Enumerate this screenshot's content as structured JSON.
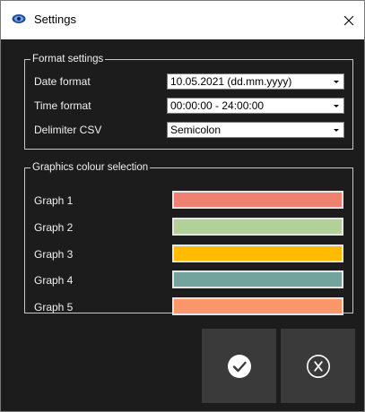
{
  "window": {
    "title": "Settings",
    "icon": "settings-app-icon",
    "close_glyph": "✕"
  },
  "format_settings": {
    "legend": "Format settings",
    "rows": [
      {
        "label": "Date format",
        "value": "10.05.2021 (dd.mm.yyyy)"
      },
      {
        "label": "Time format",
        "value": "00:00:00 - 24:00:00"
      },
      {
        "label": "Delimiter CSV",
        "value": "Semicolon"
      }
    ]
  },
  "graphics_colour_selection": {
    "legend": "Graphics colour selection",
    "rows": [
      {
        "label": "Graph 1",
        "color": "#f08070"
      },
      {
        "label": "Graph 2",
        "color": "#b2d09a"
      },
      {
        "label": "Graph 3",
        "color": "#ffbb00"
      },
      {
        "label": "Graph 4",
        "color": "#72a39c"
      },
      {
        "label": "Graph 5",
        "color": "#f9966a"
      }
    ]
  },
  "buttons": {
    "ok_icon": "checkmark-icon",
    "cancel_icon": "x-icon"
  },
  "colors": {
    "background": "#1c1c1c",
    "button_bg": "#3a3a3a",
    "border": "#c9c9c9"
  }
}
